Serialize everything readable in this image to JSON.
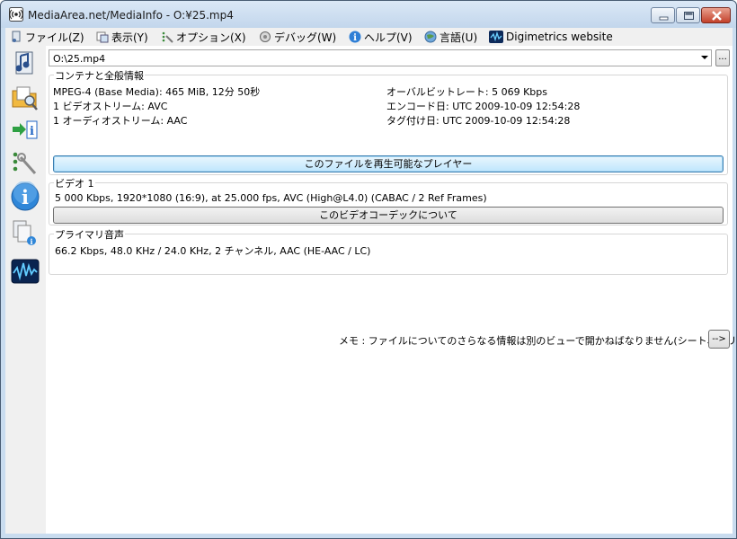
{
  "window": {
    "title": "MediaArea.net/MediaInfo - O:¥25.mp4"
  },
  "menu": {
    "items": [
      {
        "label": "ファイル(Z)",
        "icon": "file-icon"
      },
      {
        "label": "表示(Y)",
        "icon": "view-icon"
      },
      {
        "label": "オプション(X)",
        "icon": "options-icon"
      },
      {
        "label": "デバッグ(W)",
        "icon": "debug-icon"
      },
      {
        "label": "ヘルプ(V)",
        "icon": "help-icon"
      },
      {
        "label": "言語(U)",
        "icon": "language-icon"
      },
      {
        "label": "Digimetrics website",
        "icon": "digimetrics-icon"
      }
    ]
  },
  "sidebar": {
    "items": [
      "open-file-icon",
      "open-folder-icon",
      "export-icon",
      "preferences-icon",
      "about-icon",
      "sheet-view-icon",
      "digimetrics-icon"
    ]
  },
  "file_selector": {
    "value": "O:\\25.mp4",
    "browse_label": "..."
  },
  "general": {
    "label": "コンテナと全般情報",
    "left_lines": [
      "MPEG-4 (Base Media): 465 MiB, 12分 50秒",
      "1 ビデオストリーム: AVC",
      "1 オーディオストリーム: AAC"
    ],
    "right_lines": [
      "オーバルビットレート: 5 069 Kbps",
      "エンコード日: UTC 2009-10-09 12:54:28",
      "タグ付け日: UTC 2009-10-09 12:54:28"
    ],
    "button_label": "このファイルを再生可能なプレイヤー"
  },
  "video": {
    "label": "ビデオ 1",
    "line": "5 000 Kbps, 1920*1080 (16:9), at 25.000 fps, AVC (High@L4.0) (CABAC / 2 Ref Frames)",
    "button_label": "このビデオコーデックについて"
  },
  "audio": {
    "label": "プライマリ音声",
    "line": "66.2 Kbps, 48.0 KHz / 24.0 KHz, 2 チャンネル, AAC (HE-AAC / LC)"
  },
  "memo": {
    "text": "メモ : ファイルについてのさらなる情報は別のビューで開かねばなりません(シート、ツリー…)",
    "button_label": "-->"
  }
}
